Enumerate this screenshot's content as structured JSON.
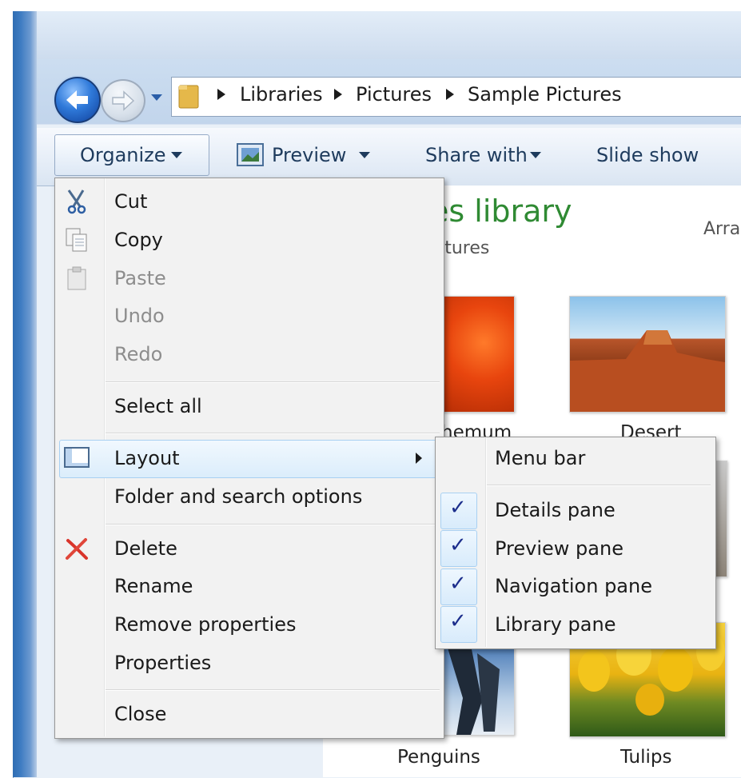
{
  "addressbar": {
    "breadcrumbs": [
      "Libraries",
      "Pictures",
      "Sample Pictures"
    ]
  },
  "toolbar": {
    "organize_label": "Organize",
    "preview_label": "Preview",
    "share_label": "Share with",
    "slideshow_label": "Slide show"
  },
  "library": {
    "title": "es library",
    "subtitle": "ictures",
    "arrange": "Arra"
  },
  "thumbnails": [
    {
      "label": "hemum"
    },
    {
      "label": "Desert"
    },
    {
      "label": "Penguins"
    },
    {
      "label": "Tulips"
    }
  ],
  "organize_menu": {
    "items": [
      {
        "label": "Cut",
        "enabled": true,
        "icon": "scissors-icon"
      },
      {
        "label": "Copy",
        "enabled": true,
        "icon": "copy-icon"
      },
      {
        "label": "Paste",
        "enabled": false,
        "icon": "clipboard-icon"
      },
      {
        "label": "Undo",
        "enabled": false
      },
      {
        "label": "Redo",
        "enabled": false
      },
      {
        "label": "Select all",
        "enabled": true
      },
      {
        "label": "Layout",
        "enabled": true,
        "icon": "layout-icon",
        "submenu": true
      },
      {
        "label": "Folder and search options",
        "enabled": true
      },
      {
        "label": "Delete",
        "enabled": true,
        "icon": "delete-x-icon"
      },
      {
        "label": "Rename",
        "enabled": true
      },
      {
        "label": "Remove properties",
        "enabled": true
      },
      {
        "label": "Properties",
        "enabled": true
      },
      {
        "label": "Close",
        "enabled": true
      }
    ]
  },
  "layout_submenu": {
    "items": [
      {
        "label": "Menu bar",
        "checked": false
      },
      {
        "label": "Details pane",
        "checked": true
      },
      {
        "label": "Preview pane",
        "checked": true
      },
      {
        "label": "Navigation pane",
        "checked": true
      },
      {
        "label": "Library pane",
        "checked": true
      }
    ]
  },
  "colors": {
    "library_title": "#2f8a33",
    "check": "#1c2e8c",
    "delete_icon": "#d9342b"
  }
}
